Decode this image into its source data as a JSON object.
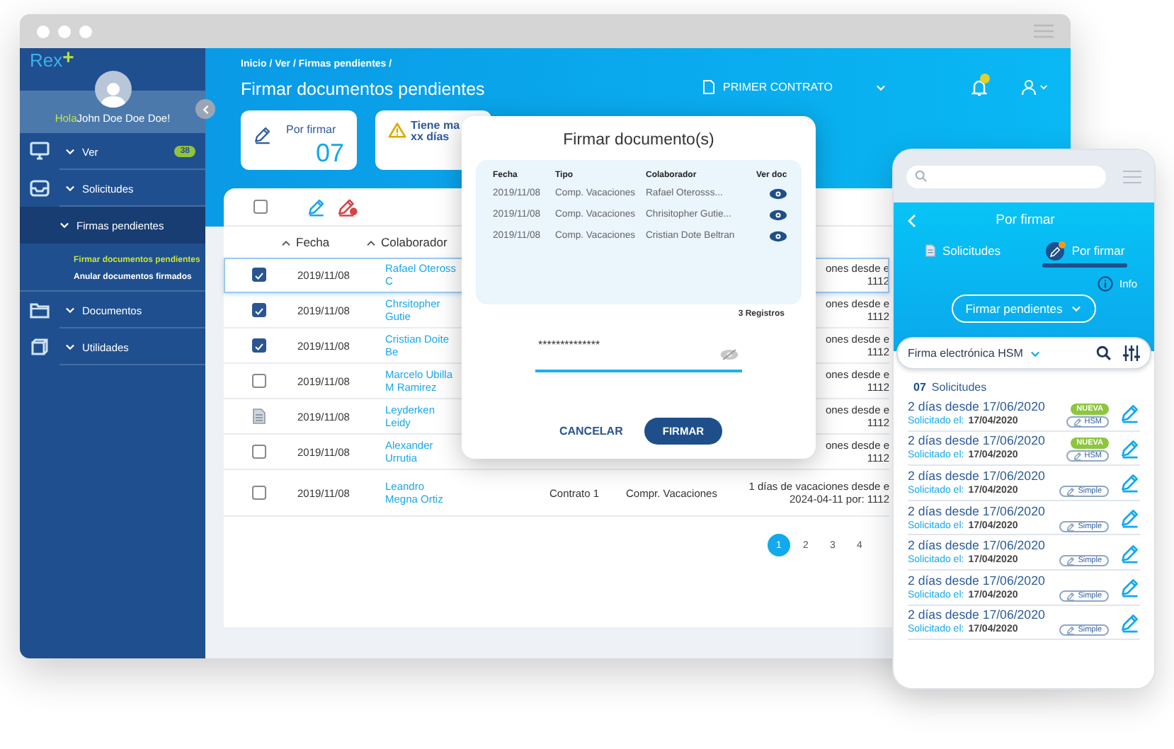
{
  "window": {
    "logo": "Rex",
    "logo_plus": "+"
  },
  "sidebar": {
    "greeting": "Hola",
    "user_name": "John Doe Doe Doe!",
    "items": [
      {
        "label": "Ver",
        "badge": "38",
        "selected": false
      },
      {
        "label": "Solicitudes",
        "selected": false,
        "children": [
          {
            "label": "Firmas pendientes",
            "selected": true,
            "children": [
              {
                "label": "Firmar documentos pendientes",
                "selected": true
              },
              {
                "label": "Anular documentos firmados",
                "selected": false
              }
            ]
          }
        ]
      },
      {
        "label": "Documentos",
        "selected": false
      },
      {
        "label": "Utilidades",
        "selected": false
      }
    ]
  },
  "header": {
    "breadcrumb": "Inicio / Ver / Firmas pendientes /",
    "title": "Firmar documentos pendientes",
    "contract": "PRIMER CONTRATO"
  },
  "cards": [
    {
      "kind": "count",
      "label": "Por firmar",
      "value": "07"
    },
    {
      "kind": "warning",
      "label": "Tiene ma",
      "detail": "xx días"
    }
  ],
  "table": {
    "select_all": false,
    "columns": [
      "Fecha",
      "Colaborador"
    ],
    "rows": [
      {
        "kind": "checkbox",
        "checked": true,
        "selected": true,
        "date": "2019/11/08",
        "name": "Rafael Oteross C",
        "desc": [
          "ones desde e",
          "1112"
        ]
      },
      {
        "kind": "checkbox",
        "checked": true,
        "selected": false,
        "date": "2019/11/08",
        "name": "Chrsitopher Gutie",
        "desc": [
          "ones desde e",
          "1112"
        ]
      },
      {
        "kind": "checkbox",
        "checked": true,
        "selected": false,
        "date": "2019/11/08",
        "name": "Cristian Doite Be",
        "desc": [
          "ones desde e",
          "1112"
        ]
      },
      {
        "kind": "checkbox",
        "checked": false,
        "selected": false,
        "date": "2019/11/08",
        "name": "Marcelo Ubilla M Ramirez",
        "desc": [
          "ones desde e",
          "1112"
        ]
      },
      {
        "kind": "document",
        "selected": false,
        "date": "2019/11/08",
        "name": "Leyderken Leidy",
        "desc": [
          "ones desde e",
          "1112"
        ]
      },
      {
        "kind": "checkbox",
        "checked": false,
        "selected": false,
        "date": "2019/11/08",
        "name": "Alexander Urrutia",
        "desc": [
          "ones desde e",
          "1112"
        ]
      },
      {
        "kind": "checkbox",
        "checked": false,
        "selected": false,
        "date": "2019/11/08",
        "name": "Leandro Megna Ortiz",
        "contract": "Contrato 1",
        "type": "Compr. Vacaciones",
        "desc": [
          "1 días de vacaciones desde e",
          "2024-04-11 por: 1112"
        ]
      }
    ]
  },
  "pagination": [
    {
      "label": "1",
      "selected": true
    },
    {
      "label": "2",
      "selected": false
    },
    {
      "label": "3",
      "selected": false
    },
    {
      "label": "4",
      "selected": false
    }
  ],
  "modal": {
    "title": "Firmar documento(s)",
    "columns": [
      "Fecha",
      "Tipo",
      "Colaborador",
      "Ver doc"
    ],
    "rows": [
      {
        "date": "2019/11/08",
        "type": "Comp. Vacaciones",
        "name": "Rafael Oterosss..."
      },
      {
        "date": "2019/11/08",
        "type": "Comp. Vacaciones",
        "name": "Chrisitopher Gutie..."
      },
      {
        "date": "2019/11/08",
        "type": "Comp. Vacaciones",
        "name": "Cristian Dote Beltran"
      }
    ],
    "records": "3 Registros",
    "password": "**************",
    "cancel": "CANCELAR",
    "confirm": "FIRMAR"
  },
  "phone": {
    "title": "Por firmar",
    "tabs": [
      {
        "label": "Solicitudes",
        "selected": false
      },
      {
        "label": "Por firmar",
        "selected": true
      }
    ],
    "info": "Info",
    "dropdown": "Firmar pendientes",
    "filter": "Firma electrónica HSM",
    "count": "07",
    "count_label": "Solicitudes",
    "items": [
      {
        "title": "2 días desde 17/06/2020",
        "requested_label": "Solicitado el:",
        "requested_date": "17/04/2020",
        "badge": "NUEVA",
        "signature": "HSM"
      },
      {
        "title": "2 días desde 17/06/2020",
        "requested_label": "Solicitado el:",
        "requested_date": "17/04/2020",
        "badge": "NUEVA",
        "signature": "HSM"
      },
      {
        "title": "2 días desde 17/06/2020",
        "requested_label": "Solicitado el:",
        "requested_date": "17/04/2020",
        "signature": "Simple"
      },
      {
        "title": "2 días desde 17/06/2020",
        "requested_label": "Solicitado el:",
        "requested_date": "17/04/2020",
        "signature": "Simple"
      },
      {
        "title": "2 días desde 17/06/2020",
        "requested_label": "Solicitado el:",
        "requested_date": "17/04/2020",
        "signature": "Simple"
      },
      {
        "title": "2 días desde 17/06/2020",
        "requested_label": "Solicitado el:",
        "requested_date": "17/04/2020",
        "signature": "Simple"
      },
      {
        "title": "2 días desde 17/06/2020",
        "requested_label": "Solicitado el:",
        "requested_date": "17/04/2020",
        "signature": "Simple"
      }
    ]
  }
}
